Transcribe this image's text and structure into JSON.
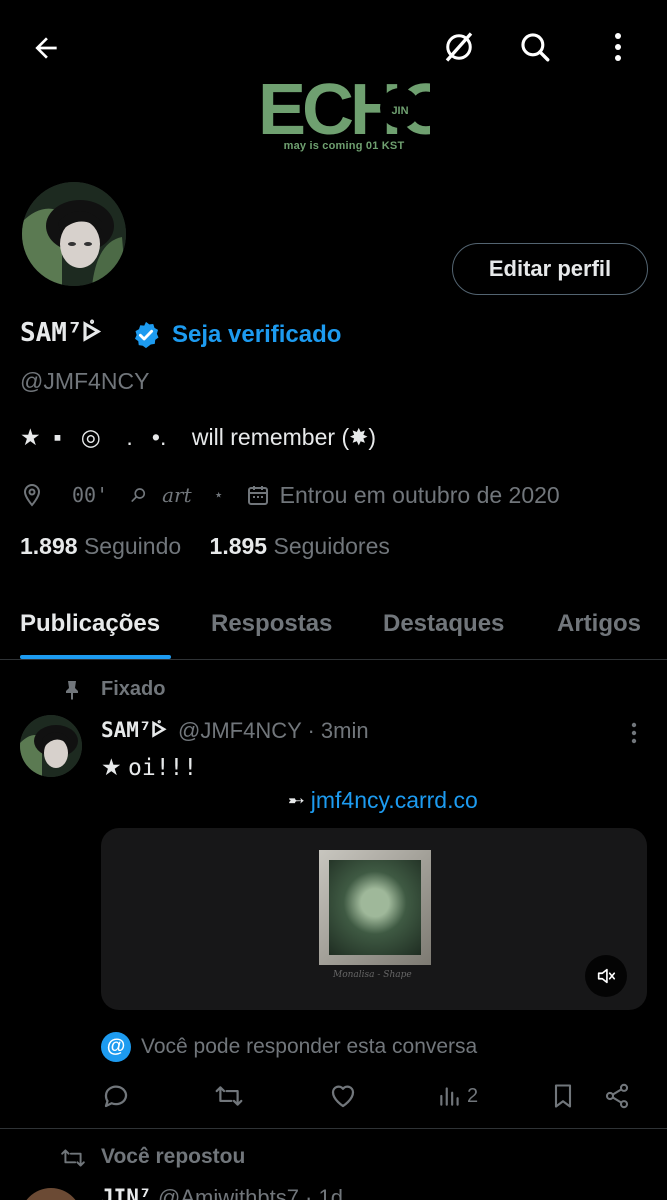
{
  "header": {
    "back_icon": "arrow-left-icon",
    "grok_icon": "grok-icon",
    "search_icon": "search-icon",
    "more_icon": "more-vertical-icon"
  },
  "banner": {
    "logo_text": "ECHO",
    "logo_tag": "JIN",
    "subtitle": "may is coming 01 KST",
    "logo_color": "#6fa070"
  },
  "profile": {
    "edit_button": "Editar perfil",
    "name": "SAM⁷ᢰ",
    "verify_link": "Seja verificado",
    "handle": "@JMF4NCY",
    "bio": "★  ▪   ◎    .   •.    will remember (✸)",
    "meta": {
      "location": "00'",
      "link": "art",
      "star": "⋆",
      "joined": "Entrou em outubro de 2020"
    },
    "following_count": "1.898",
    "following_label": "Seguindo",
    "followers_count": "1.895",
    "followers_label": "Seguidores"
  },
  "tabs": [
    {
      "label": "Publicações",
      "active": true
    },
    {
      "label": "Respostas",
      "active": false
    },
    {
      "label": "Destaques",
      "active": false
    },
    {
      "label": "Artigos",
      "active": false
    }
  ],
  "pinned_tweet": {
    "pinned_label": "Fixado",
    "name": "SAM⁷ᢰ",
    "handle_time": "@JMF4NCY · 3min",
    "text_prefix": "★ ",
    "text_body": "oi!!!",
    "link_arrow": "➸",
    "link_text": "jmf4ncy.carrd.co",
    "media_caption": "Monalisa - Shape",
    "reply_note": "Você pode responder esta conversa",
    "views": "2"
  },
  "next_tweet": {
    "repost_label": "Você repostou",
    "name": "JIN⁷",
    "handle_time": "@Amiwithbts7 · 1d"
  },
  "colors": {
    "accent": "#1d9bf0",
    "muted": "#71767b",
    "text": "#e7e9ea",
    "border": "#2f3336"
  }
}
